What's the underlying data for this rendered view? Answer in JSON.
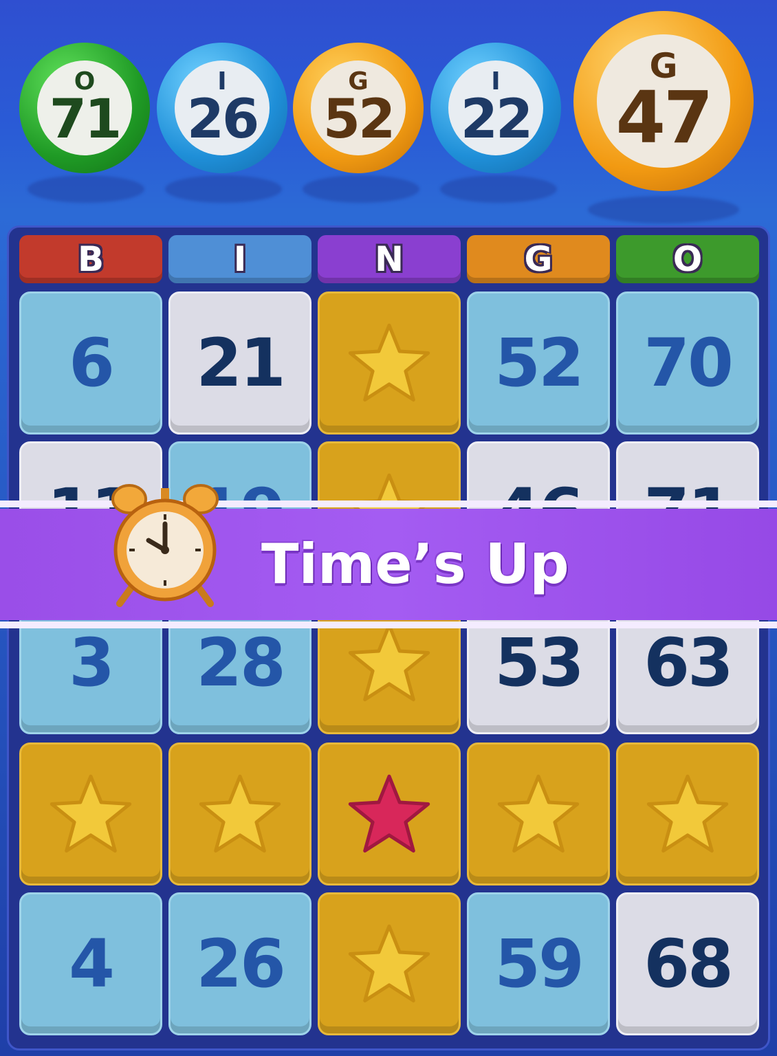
{
  "called_balls": [
    {
      "letter": "O",
      "number": "71",
      "color": "green"
    },
    {
      "letter": "I",
      "number": "26",
      "color": "blue"
    },
    {
      "letter": "G",
      "number": "52",
      "color": "orange"
    },
    {
      "letter": "I",
      "number": "22",
      "color": "blue"
    }
  ],
  "current_ball": {
    "letter": "G",
    "number": "47",
    "color": "orange"
  },
  "headers": [
    "B",
    "I",
    "N",
    "G",
    "O"
  ],
  "header_colors": [
    "#c23a2c",
    "#4f8fd6",
    "#8a3fd0",
    "#e08a1e",
    "#3d9a2c"
  ],
  "grid": {
    "row1": [
      "6",
      "21",
      "",
      "52",
      "70"
    ],
    "row2": [
      "11",
      "19",
      "",
      "46",
      "71"
    ],
    "row3": [
      "3",
      "28",
      "",
      "53",
      "63"
    ],
    "row4": [
      "",
      "",
      "",
      "",
      ""
    ],
    "row5": [
      "4",
      "26",
      "",
      "59",
      "68"
    ]
  },
  "banner": {
    "text": "Time’s Up"
  },
  "colors": {
    "star_gold": "#f2c93a",
    "star_red": "#d8275a",
    "banner": "#a45cf2"
  }
}
